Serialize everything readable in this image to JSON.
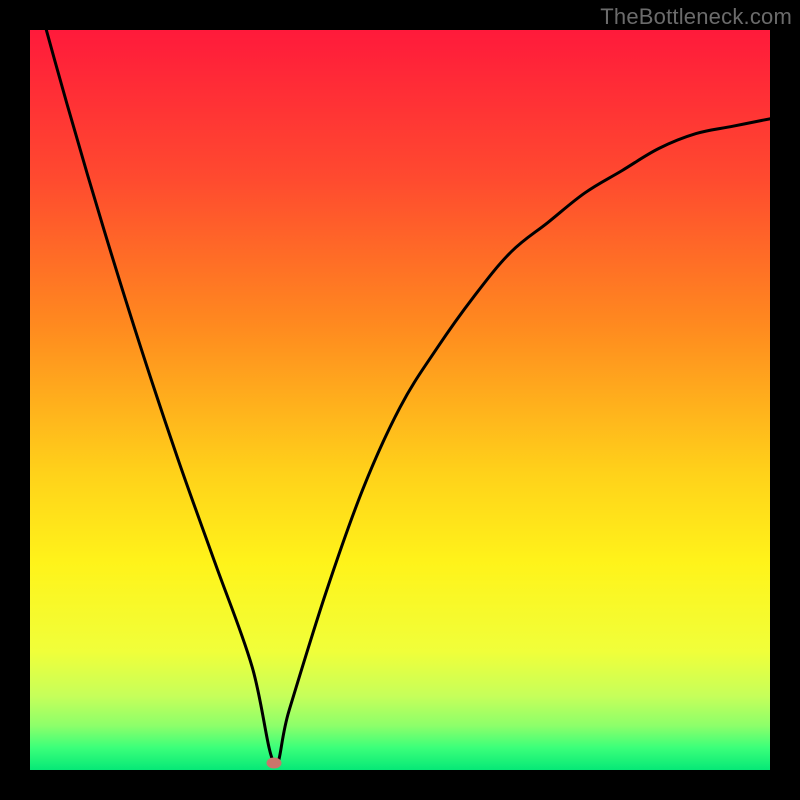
{
  "watermark": "TheBottleneck.com",
  "colors": {
    "background_black": "#000000",
    "curve_stroke": "#000000",
    "marker_fill": "#c9766b",
    "gradient_stops": [
      {
        "offset": 0,
        "color": "#ff1a3b"
      },
      {
        "offset": 20,
        "color": "#ff4a2f"
      },
      {
        "offset": 40,
        "color": "#ff8a1f"
      },
      {
        "offset": 60,
        "color": "#ffd21a"
      },
      {
        "offset": 72,
        "color": "#fff31a"
      },
      {
        "offset": 84,
        "color": "#f0ff3a"
      },
      {
        "offset": 90,
        "color": "#c6ff5a"
      },
      {
        "offset": 94,
        "color": "#8dff6a"
      },
      {
        "offset": 97,
        "color": "#3bff7a"
      },
      {
        "offset": 100,
        "color": "#06e877"
      }
    ]
  },
  "chart_data": {
    "type": "line",
    "title": "",
    "xlabel": "",
    "ylabel": "",
    "xlim": [
      0,
      100
    ],
    "ylim": [
      0,
      100
    ],
    "grid": false,
    "x": [
      0,
      5,
      10,
      15,
      20,
      25,
      30,
      33,
      35,
      40,
      45,
      50,
      55,
      60,
      65,
      70,
      75,
      80,
      85,
      90,
      95,
      100
    ],
    "series": [
      {
        "name": "bottleneck-curve",
        "values": [
          108,
          90,
          73,
          57,
          42,
          28,
          14,
          1,
          8,
          24,
          38,
          49,
          57,
          64,
          70,
          74,
          78,
          81,
          84,
          86,
          87,
          88
        ]
      }
    ],
    "marker": {
      "x": 33,
      "y": 1
    }
  }
}
